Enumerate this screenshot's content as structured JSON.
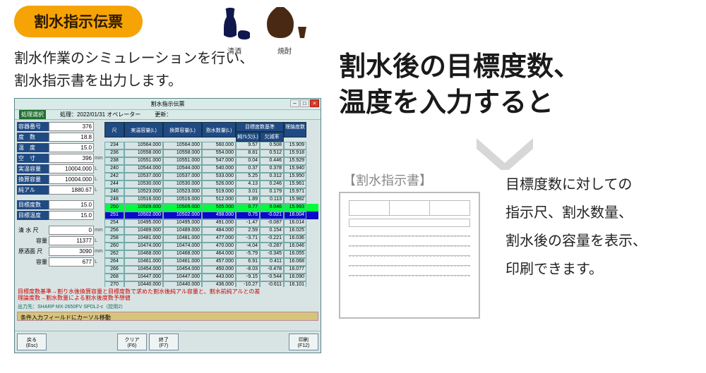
{
  "badge_label": "割水指示伝票",
  "icons": {
    "sake": "清酒",
    "shochu": "焼酎"
  },
  "desc_line1": "割水作業のシミュレーションを行い、",
  "desc_line2": "割水指示書を出力します。",
  "app": {
    "title": "割水指示伝票",
    "processing_select": "処理選択",
    "proc_date_label": "処理：",
    "proc_date": "2022/01/31 オペレーター",
    "update_label": "更新：",
    "fields": {
      "youkibangou": {
        "label": "容器番号",
        "value": "376"
      },
      "dosuu": {
        "label": "度　数",
        "value": "18.8"
      },
      "ondo": {
        "label": "温　度",
        "value": "15.0"
      },
      "kusun": {
        "label": "空　寸",
        "value": "396",
        "unit": "mm"
      },
      "jituon": {
        "label": "実温容量",
        "value": "10004.000",
        "unit": "L"
      },
      "kansan": {
        "label": "換算容量",
        "value": "10004.000",
        "unit": "L"
      },
      "junaru": {
        "label": "純アル",
        "value": "1880.67",
        "unit": "L"
      },
      "mokuhyodo": {
        "label": "目標度数",
        "value": "15.0"
      },
      "mokuhyoondo": {
        "label": "目標温度",
        "value": "15.0"
      },
      "seisui_shaku": {
        "label": "清 水  尺",
        "value": "0",
        "unit": "mm"
      },
      "seisui_youryou": {
        "label": "容量",
        "value": "11377",
        "unit": "L"
      },
      "genshumen_shaku": {
        "label": "原酒面 尺",
        "value": "3090",
        "unit": "mm"
      },
      "genshumen_youryou": {
        "label": "容量",
        "value": "677",
        "unit": "L"
      }
    },
    "grid": {
      "headers": {
        "shaku": "尺",
        "jituon": "実温容量(L)",
        "kansan": "換算容量(L)",
        "warimizu": "割水数量(L)",
        "mokuhyo_group": "目標度数基準",
        "junaru_ketsu": "純ｱﾙ欠(L)",
        "ketsuritu": "欠減率",
        "rironteki": "理論度数"
      },
      "rows": [
        {
          "s": "234",
          "a": "10564.000",
          "b": "10564.000",
          "c": "560.000",
          "d": "9.57",
          "e": "0.508",
          "f": "15.909"
        },
        {
          "s": "236",
          "a": "10558.000",
          "b": "10558.000",
          "c": "554.000",
          "d": "8.81",
          "e": "0.512",
          "f": "15.918"
        },
        {
          "s": "238",
          "a": "10551.000",
          "b": "10551.000",
          "c": "547.000",
          "d": "0.04",
          "e": "0.446",
          "f": "15.929"
        },
        {
          "s": "240",
          "a": "10544.000",
          "b": "10544.000",
          "c": "540.000",
          "d": "0.37",
          "e": "0.378",
          "f": "15.940"
        },
        {
          "s": "242",
          "a": "10537.000",
          "b": "10537.000",
          "c": "533.000",
          "d": "5.25",
          "e": "0.312",
          "f": "15.950"
        },
        {
          "s": "244",
          "a": "10530.000",
          "b": "10530.000",
          "c": "526.000",
          "d": "4.13",
          "e": "0.246",
          "f": "15.961"
        },
        {
          "s": "246",
          "a": "10523.000",
          "b": "10523.000",
          "c": "519.000",
          "d": "3.01",
          "e": "0.179",
          "f": "15.971"
        },
        {
          "s": "248",
          "a": "10516.000",
          "b": "10516.000",
          "c": "512.000",
          "d": "1.89",
          "e": "0.113",
          "f": "15.982"
        },
        {
          "s": "250",
          "a": "10509.000",
          "b": "10509.000",
          "c": "505.000",
          "d": "0.77",
          "e": "0.046",
          "f": "15.993",
          "hl": true
        },
        {
          "s": "251",
          "a": "10502.000",
          "b": "10502.000",
          "c": "498.000",
          "d": "0.75",
          "e": "-0.021",
          "f": "16.004",
          "sel": true
        },
        {
          "s": "254",
          "a": "10495.000",
          "b": "10495.000",
          "c": "491.000",
          "d": "-1.47",
          "e": "-0.087",
          "f": "16.014"
        },
        {
          "s": "256",
          "a": "10489.000",
          "b": "10489.000",
          "c": "484.000",
          "d": "2.59",
          "e": "0.154",
          "f": "16.025"
        },
        {
          "s": "258",
          "a": "10481.000",
          "b": "10481.000",
          "c": "477.000",
          "d": "-3.71",
          "e": "-0.221",
          "f": "16.036"
        },
        {
          "s": "260",
          "a": "10474.000",
          "b": "10474.000",
          "c": "470.000",
          "d": "-4.04",
          "e": "-0.287",
          "f": "16.046"
        },
        {
          "s": "262",
          "a": "10468.000",
          "b": "10468.000",
          "c": "464.000",
          "d": "-5.79",
          "e": "-0.345",
          "f": "16.055"
        },
        {
          "s": "264",
          "a": "10461.000",
          "b": "10461.000",
          "c": "457.000",
          "d": "6.91",
          "e": "0.411",
          "f": "16.068"
        },
        {
          "s": "266",
          "a": "10454.000",
          "b": "10454.000",
          "c": "450.000",
          "d": "-8.03",
          "e": "-0.478",
          "f": "16.077"
        },
        {
          "s": "268",
          "a": "10447.000",
          "b": "10447.000",
          "c": "443.000",
          "d": "-9.15",
          "e": "-0.544",
          "f": "16.090"
        },
        {
          "s": "270",
          "a": "10440.000",
          "b": "10440.000",
          "c": "436.000",
          "d": "-10.27",
          "e": "-0.611",
          "f": "16.101"
        }
      ]
    },
    "note1": "目標度数基準→割り水後換算容量と目標度数で求めた割水後純アル容量と、割水前純アルとの差",
    "note2": "理論度数→割水数量による割水後度数予想値",
    "print_dest": "出力先：SHARP MX-2650FV SPDL2-c（控用2）",
    "help_strip": "条件入力フィールドにカーソル移動",
    "buttons": {
      "back": "戻る\n(Esc)",
      "clear": "クリア\n(F6)",
      "end": "終了\n(F7)",
      "print": "印刷\n(F12)"
    }
  },
  "big_heading_l1": "割水後の目標度数、",
  "big_heading_l2": "温度を入力すると",
  "doc_title": "【割水指示書】",
  "result_l1": "目標度数に対しての",
  "result_l2": "指示尺、割水数量、",
  "result_l3": "割水後の容量を表示、",
  "result_l4": "印刷できます。"
}
